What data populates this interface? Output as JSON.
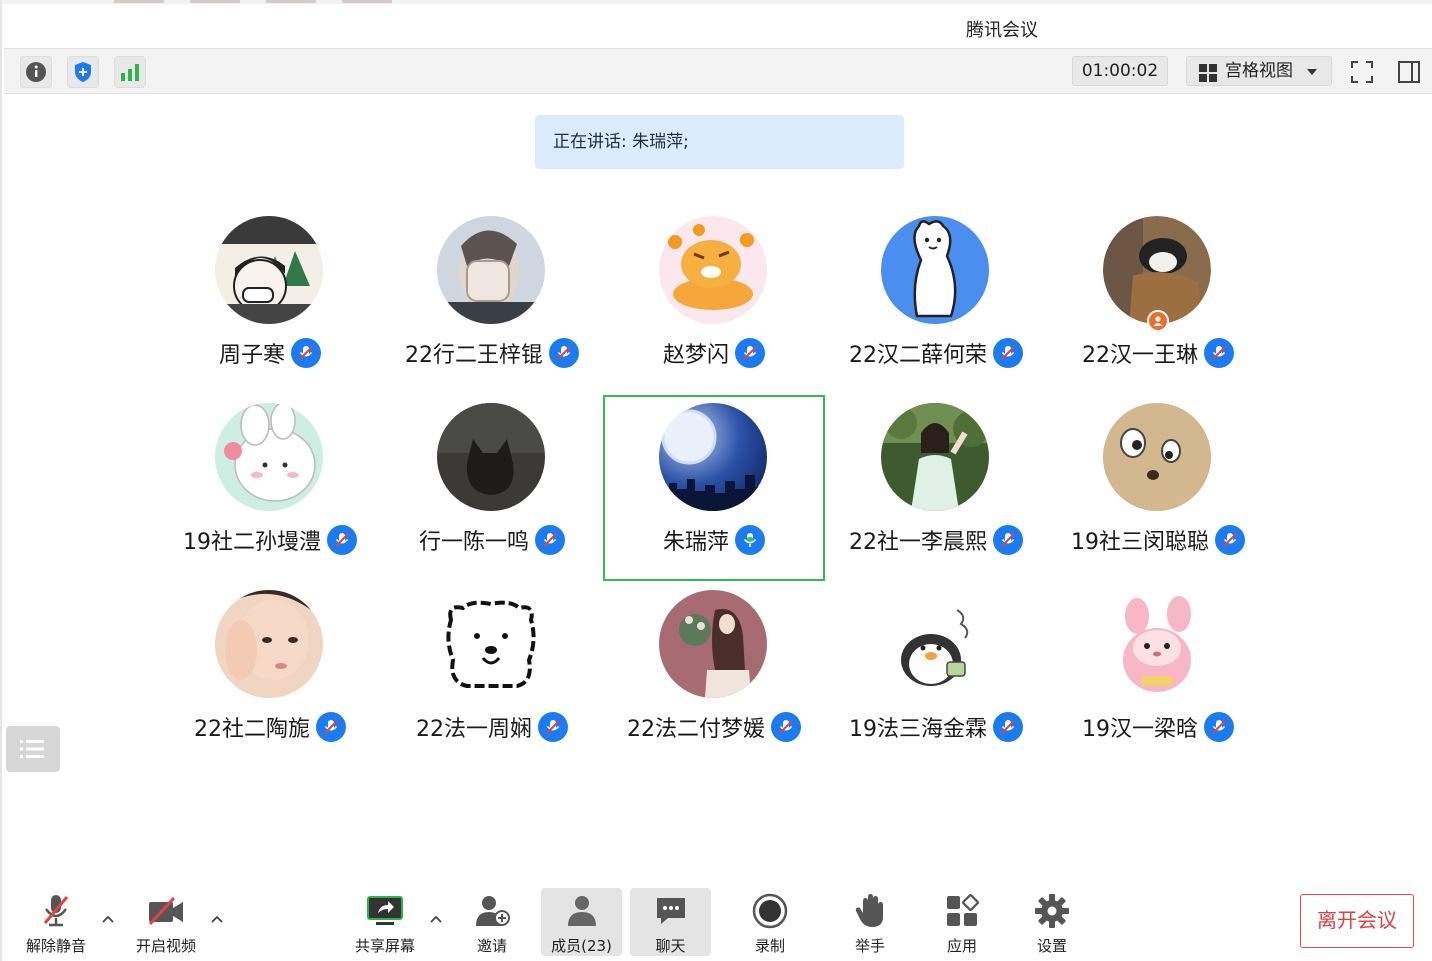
{
  "window": {
    "title": "腾讯会议"
  },
  "toolbar": {
    "timer": "01:00:02",
    "view_label": "宫格视图"
  },
  "speaking": {
    "text": "正在讲话: 朱瑞萍;"
  },
  "participants": [
    {
      "name": "周子寒",
      "mic": "muted"
    },
    {
      "name": "22行二王梓锟",
      "mic": "muted"
    },
    {
      "name": "赵梦闪",
      "mic": "muted"
    },
    {
      "name": "22汉二薛何荣",
      "mic": "muted"
    },
    {
      "name": "22汉一王琳",
      "mic": "muted"
    },
    {
      "name": "19社二孙墁澧",
      "mic": "muted"
    },
    {
      "name": "行一陈一鸣",
      "mic": "muted"
    },
    {
      "name": "朱瑞萍",
      "mic": "speaking"
    },
    {
      "name": "22社一李晨熙",
      "mic": "muted"
    },
    {
      "name": "19社三闵聪聪",
      "mic": "muted"
    },
    {
      "name": "22社二陶旎",
      "mic": "muted"
    },
    {
      "name": "22法一周娴",
      "mic": "muted"
    },
    {
      "name": "22法二付梦媛",
      "mic": "muted"
    },
    {
      "name": "19法三海金霖",
      "mic": "muted"
    },
    {
      "name": "19汉一梁晗",
      "mic": "muted"
    }
  ],
  "bottom": {
    "unmute": "解除静音",
    "start_video": "开启视频",
    "share_screen": "共享屏幕",
    "invite": "邀请",
    "members": "成员(23)",
    "chat": "聊天",
    "record": "录制",
    "raise_hand": "举手",
    "apps": "应用",
    "settings": "设置",
    "leave": "离开会议"
  },
  "colors": {
    "accent": "#1a7cf0",
    "speaking_border": "#2dbb5c",
    "leave_red": "#e04040",
    "banner_bg": "#dcebfb"
  }
}
